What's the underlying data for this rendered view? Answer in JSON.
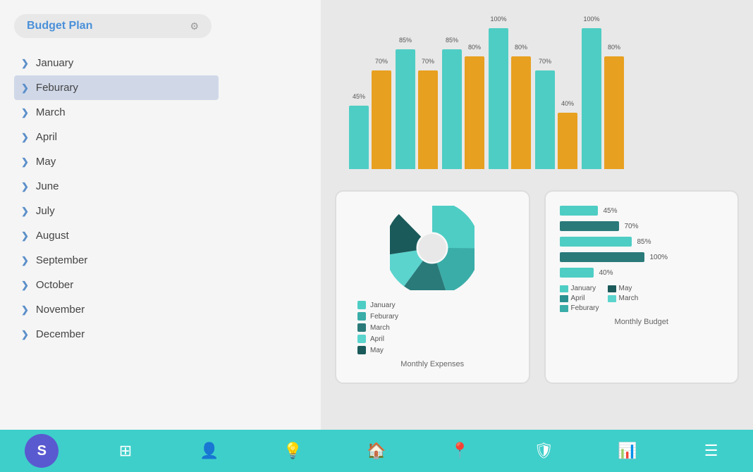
{
  "sidebar": {
    "header": {
      "title": "Budget Plan",
      "icon": "⚙"
    },
    "months": [
      {
        "label": "January",
        "active": false
      },
      {
        "label": "Feburary",
        "active": true
      },
      {
        "label": "March",
        "active": false
      },
      {
        "label": "April",
        "active": false
      },
      {
        "label": "May",
        "active": false
      },
      {
        "label": "June",
        "active": false
      },
      {
        "label": "July",
        "active": false
      },
      {
        "label": "August",
        "active": false
      },
      {
        "label": "September",
        "active": false
      },
      {
        "label": "October",
        "active": false
      },
      {
        "label": "November",
        "active": false
      },
      {
        "label": "December",
        "active": false
      }
    ]
  },
  "barChart": {
    "groups": [
      {
        "teal": 45,
        "gold": 70,
        "tealLabel": "45%",
        "goldLabel": "70%"
      },
      {
        "teal": 85,
        "gold": 70,
        "tealLabel": "85%",
        "goldLabel": "70%"
      },
      {
        "teal": 85,
        "gold": 80,
        "tealLabel": "85%",
        "goldLabel": "80%"
      },
      {
        "teal": 100,
        "gold": 80,
        "tealLabel": "100%",
        "goldLabel": "80%"
      },
      {
        "teal": 70,
        "gold": 40,
        "tealLabel": "70%",
        "goldLabel": "40%"
      },
      {
        "teal": 100,
        "gold": 80,
        "tealLabel": "100%",
        "goldLabel": "80%"
      }
    ]
  },
  "pieChart": {
    "title": "Monthly Expenses",
    "legend": [
      {
        "label": "January",
        "color": "#4ecdc4"
      },
      {
        "label": "Feburary",
        "color": "#3aada8"
      },
      {
        "label": "March",
        "color": "#2a7a7a"
      },
      {
        "label": "April",
        "color": "#5bd4ce"
      },
      {
        "label": "May",
        "color": "#1a5a5a"
      }
    ]
  },
  "budgetCard": {
    "title": "Monthly Budget",
    "rows": [
      {
        "label": "45%",
        "pct": 45
      },
      {
        "label": "70%",
        "pct": 70
      },
      {
        "label": "85%",
        "pct": 85
      },
      {
        "label": "100%",
        "pct": 100
      },
      {
        "label": "40%",
        "pct": 40
      }
    ],
    "legend": [
      {
        "label": "January",
        "color": "#4ecdc4"
      },
      {
        "label": "April",
        "color": "#2a9090"
      },
      {
        "label": "Feburary",
        "color": "#3aada8"
      },
      {
        "label": "May",
        "color": "#1a5a5a"
      },
      {
        "label": "March",
        "color": "#5bd4ce"
      }
    ]
  },
  "bottomNav": {
    "items": [
      {
        "icon": "S",
        "type": "circle",
        "name": "home-nav"
      },
      {
        "icon": "⊞",
        "type": "icon",
        "name": "grid-nav"
      },
      {
        "icon": "👤",
        "type": "icon",
        "name": "user-nav"
      },
      {
        "icon": "💡",
        "type": "icon",
        "name": "idea-nav"
      },
      {
        "icon": "🏠",
        "type": "icon",
        "name": "house-nav"
      },
      {
        "icon": "📍",
        "type": "icon",
        "name": "location-nav"
      },
      {
        "icon": "🛡",
        "type": "icon",
        "name": "shield-nav"
      },
      {
        "icon": "📊",
        "type": "icon",
        "name": "chart-nav"
      },
      {
        "icon": "☰",
        "type": "icon",
        "name": "menu-nav"
      }
    ]
  }
}
